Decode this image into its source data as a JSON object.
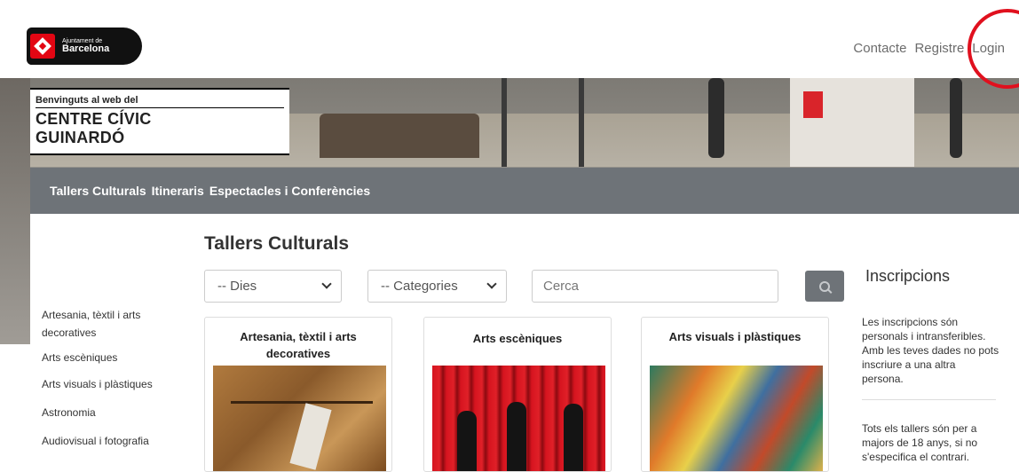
{
  "header": {
    "logo": {
      "line1": "Ajuntament de",
      "line2": "Barcelona"
    },
    "nav": [
      "Contacte",
      "Registre",
      "Login"
    ]
  },
  "hero": {
    "welcome_line": "Benvinguts al web del",
    "center_name_line1": "CENTRE CÍVIC",
    "center_name_line2": "GUINARDÓ"
  },
  "main_nav": [
    "Tallers Culturals",
    "Itineraris",
    "Espectacles i Conferències"
  ],
  "main": {
    "title": "Tallers Culturals",
    "filters": {
      "days_selected": "-- Dies",
      "categories_selected": "-- Categories",
      "search_placeholder": "Cerca"
    },
    "sidebar_categories": [
      "Artesania, tèxtil i arts decoratives",
      "Arts escèniques",
      "Arts visuals i plàstiques",
      "Astronomia",
      "Audiovisual i fotografia"
    ],
    "cards": [
      {
        "title": "Artesania, tèxtil i arts decoratives"
      },
      {
        "title": "Arts escèniques"
      },
      {
        "title": "Arts visuals i plàstiques"
      }
    ]
  },
  "inscriptions": {
    "title": "Inscripcions",
    "text1": "Les inscripcions són personals i intransferibles. Amb les teves dades no pots inscriure a una altra persona.",
    "text2": "Tots els tallers són per a majors de 18 anys, si no s'especifica el contrari."
  },
  "colors": {
    "nav_bg": "#6e7378",
    "highlight_circle": "#e0101e",
    "brand_red": "#e30613"
  }
}
